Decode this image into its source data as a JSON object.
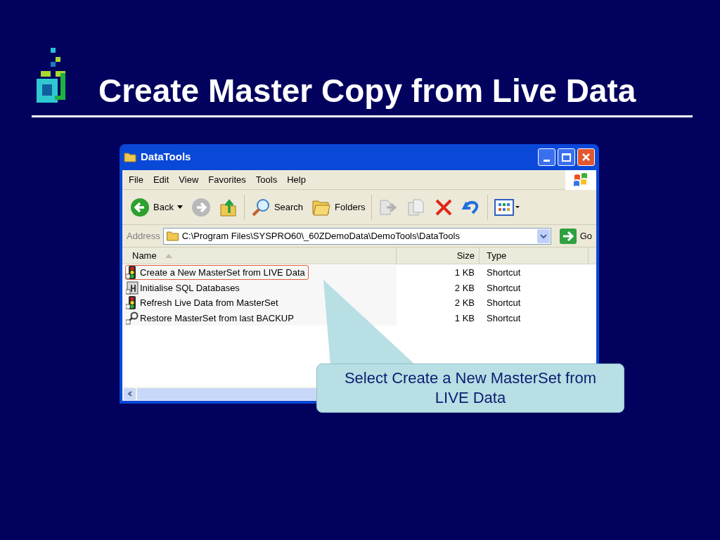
{
  "slide": {
    "title": "Create Master Copy from Live Data"
  },
  "window": {
    "title": "DataTools",
    "menu": [
      "File",
      "Edit",
      "View",
      "Favorites",
      "Tools",
      "Help"
    ],
    "toolbar": [
      {
        "kind": "back",
        "label": "Back"
      },
      {
        "kind": "forward"
      },
      {
        "kind": "up"
      },
      {
        "kind": "search",
        "label": "Search"
      },
      {
        "kind": "folders",
        "label": "Folders"
      },
      {
        "kind": "move"
      },
      {
        "kind": "copy"
      },
      {
        "kind": "delete"
      },
      {
        "kind": "undo"
      },
      {
        "kind": "views"
      }
    ],
    "address": {
      "label": "Address",
      "value": "C:\\Program Files\\SYSPRO60\\_60ZDemoData\\DemoTools\\DataTools",
      "go": "Go"
    },
    "columns": [
      "Name",
      "Size",
      "Type"
    ],
    "files": [
      {
        "name": "Create a New MasterSet from LIVE Data",
        "size": "1 KB",
        "type": "Shortcut",
        "kind": "traffic",
        "highlighted": true
      },
      {
        "name": "Initialise SQL Databases",
        "size": "2 KB",
        "type": "Shortcut",
        "kind": "sql",
        "highlighted": false
      },
      {
        "name": "Refresh Live Data from MasterSet",
        "size": "2 KB",
        "type": "Shortcut",
        "kind": "traffic",
        "highlighted": false
      },
      {
        "name": "Restore MasterSet from last BACKUP",
        "size": "1 KB",
        "type": "Shortcut",
        "kind": "restore",
        "highlighted": false
      }
    ]
  },
  "callout": {
    "text": "Select Create a New MasterSet from LIVE Data"
  }
}
